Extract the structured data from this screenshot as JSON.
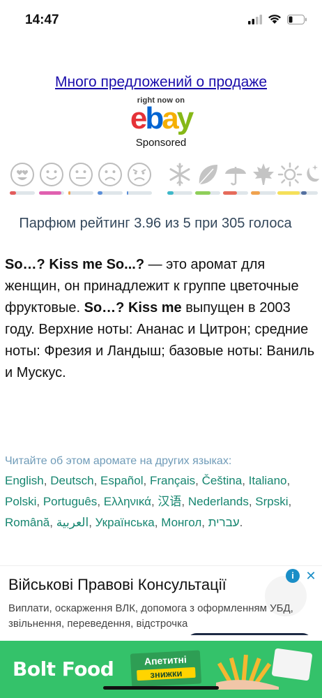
{
  "status": {
    "time": "14:47"
  },
  "ebay": {
    "link_text": "Много предложений о продаже",
    "right_now": "right now on",
    "sponsored": "Sponsored"
  },
  "rating_icons": {
    "moods": [
      {
        "icon": "love-face-icon",
        "color": "#e25c5c",
        "level": 0.25
      },
      {
        "icon": "smile-face-icon",
        "color": "#e060b0",
        "level": 0.7
      },
      {
        "icon": "neutral-face-icon",
        "color": "#f0a24f",
        "level": 0.1
      },
      {
        "icon": "sad-face-icon",
        "color": "#5b8fd8",
        "level": 0.06
      },
      {
        "icon": "angry-face-icon",
        "color": "#5b8fd8",
        "level": 0.04
      }
    ],
    "seasons": [
      {
        "icon": "winter-snowflake-icon",
        "color": "#3fb8c9",
        "level": 0.15
      },
      {
        "icon": "spring-leaf-icon",
        "color": "#8fcf5a",
        "level": 0.65
      },
      {
        "icon": "summer-umbrella-icon",
        "color": "#e66b5b",
        "level": 0.55
      },
      {
        "icon": "autumn-maple-leaf-icon",
        "color": "#f0a24f",
        "level": 0.35
      },
      {
        "icon": "day-sun-icon",
        "color": "#f5e05a",
        "level": 0.9
      },
      {
        "icon": "night-moon-icon",
        "color": "#5470a0",
        "level": 0.25
      }
    ]
  },
  "rating": {
    "text": "Парфюм рейтинг 3.96 из 5 при 305 голоса"
  },
  "description": {
    "name_1": "So…? Kiss me So...?",
    "text_1": " — это аромат для женщин, он принадлежит к группе цветочные фруктовые. ",
    "name_2": "So…? Kiss me",
    "text_2": " выпущен в 2003 году. Верхние ноты: Ананас и Цитрон; средние ноты: Фрезия и Ландыш; базовые ноты: Ваниль и Мускус."
  },
  "languages": {
    "title": "Читайте об этом аромате на других языках:",
    "items": [
      "English",
      "Deutsch",
      "Español",
      "Français",
      "Čeština",
      "Italiano",
      "Polski",
      "Português",
      "Ελληνικά",
      "汉语",
      "Nederlands",
      "Srpski",
      "Română",
      "العربية",
      "Українська",
      "Монгол",
      "עברית"
    ]
  },
  "ad1": {
    "title": "Військові Правові Консультації",
    "text": "Виплати, оскарження ВЛК, допомога з оформленням УБД, звільнення, переведення, відстрочка"
  },
  "ad2": {
    "brand": "Bolt Food",
    "tag_line_1": "Апетитні",
    "tag_line_2": "знижки"
  }
}
